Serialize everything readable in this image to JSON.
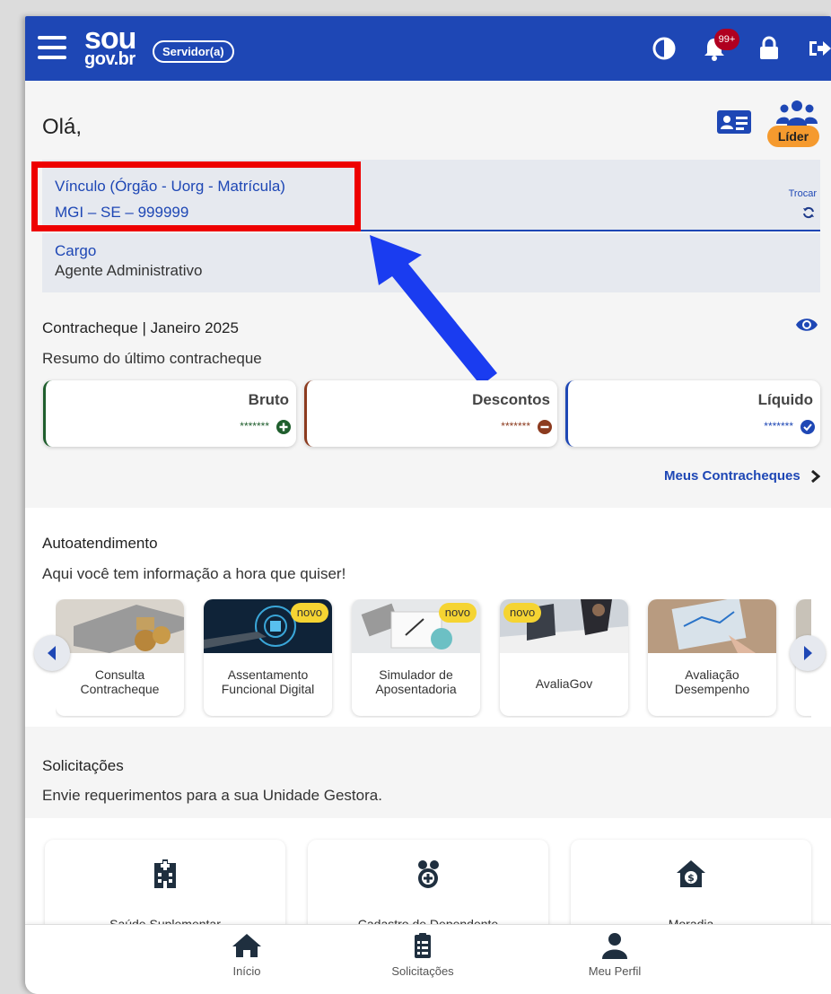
{
  "header": {
    "logo_top": "sou",
    "logo_bottom": "gov.br",
    "role": "Servidor(a)",
    "notifications": "99+"
  },
  "greeting": "Olá,",
  "lider_label": "Líder",
  "vinculo": {
    "label": "Vínculo (Órgão - Uorg - Matrícula)",
    "value": "MGI – SE – 999999",
    "trocar": "Trocar"
  },
  "cargo": {
    "label": "Cargo",
    "value": "Agente Administrativo"
  },
  "contracheque": {
    "title": "Contracheque | Janeiro 2025",
    "subtitle": "Resumo do último contracheque",
    "cards": [
      {
        "label": "Bruto",
        "value": "*******",
        "color": "#1f5e2d"
      },
      {
        "label": "Descontos",
        "value": "*******",
        "color": "#8c3b1f"
      },
      {
        "label": "Líquido",
        "value": "*******",
        "color": "#1e47b5"
      }
    ],
    "link": "Meus Contracheques"
  },
  "autoatendimento": {
    "title": "Autoatendimento",
    "subtitle": "Aqui você tem informação a hora que quiser!",
    "tiles": [
      {
        "label": "Consulta Contracheque",
        "line1": "Consulta",
        "line2": "Contracheque"
      },
      {
        "label": "Assentamento Funcional Digital",
        "line1": "Assentamento",
        "line2": "Funcional Digital",
        "badge": "novo"
      },
      {
        "label": "Simulador de Aposentadoria",
        "line1": "Simulador de",
        "line2": "Aposentadoria",
        "badge": "novo"
      },
      {
        "label": "AvaliaGov",
        "line1": "AvaliaGov",
        "badge": "novo"
      },
      {
        "label": "Avaliação Desempenho",
        "line1": "Avaliação",
        "line2": "Desempenho"
      }
    ]
  },
  "solicitacoes": {
    "title": "Solicitações",
    "subtitle": "Envie requerimentos para a sua Unidade Gestora.",
    "cards": [
      "Saúde Suplementar",
      "Cadastro de Dependente",
      "Moradia"
    ]
  },
  "bottom_nav": [
    "Início",
    "Solicitações",
    "Meu Perfil"
  ],
  "colors": {
    "brand": "#1e47b5",
    "highlight": "#ee0000",
    "arrow": "#1a3cf0",
    "badge_novo": "#f5d432",
    "lider": "#f59a2e"
  }
}
